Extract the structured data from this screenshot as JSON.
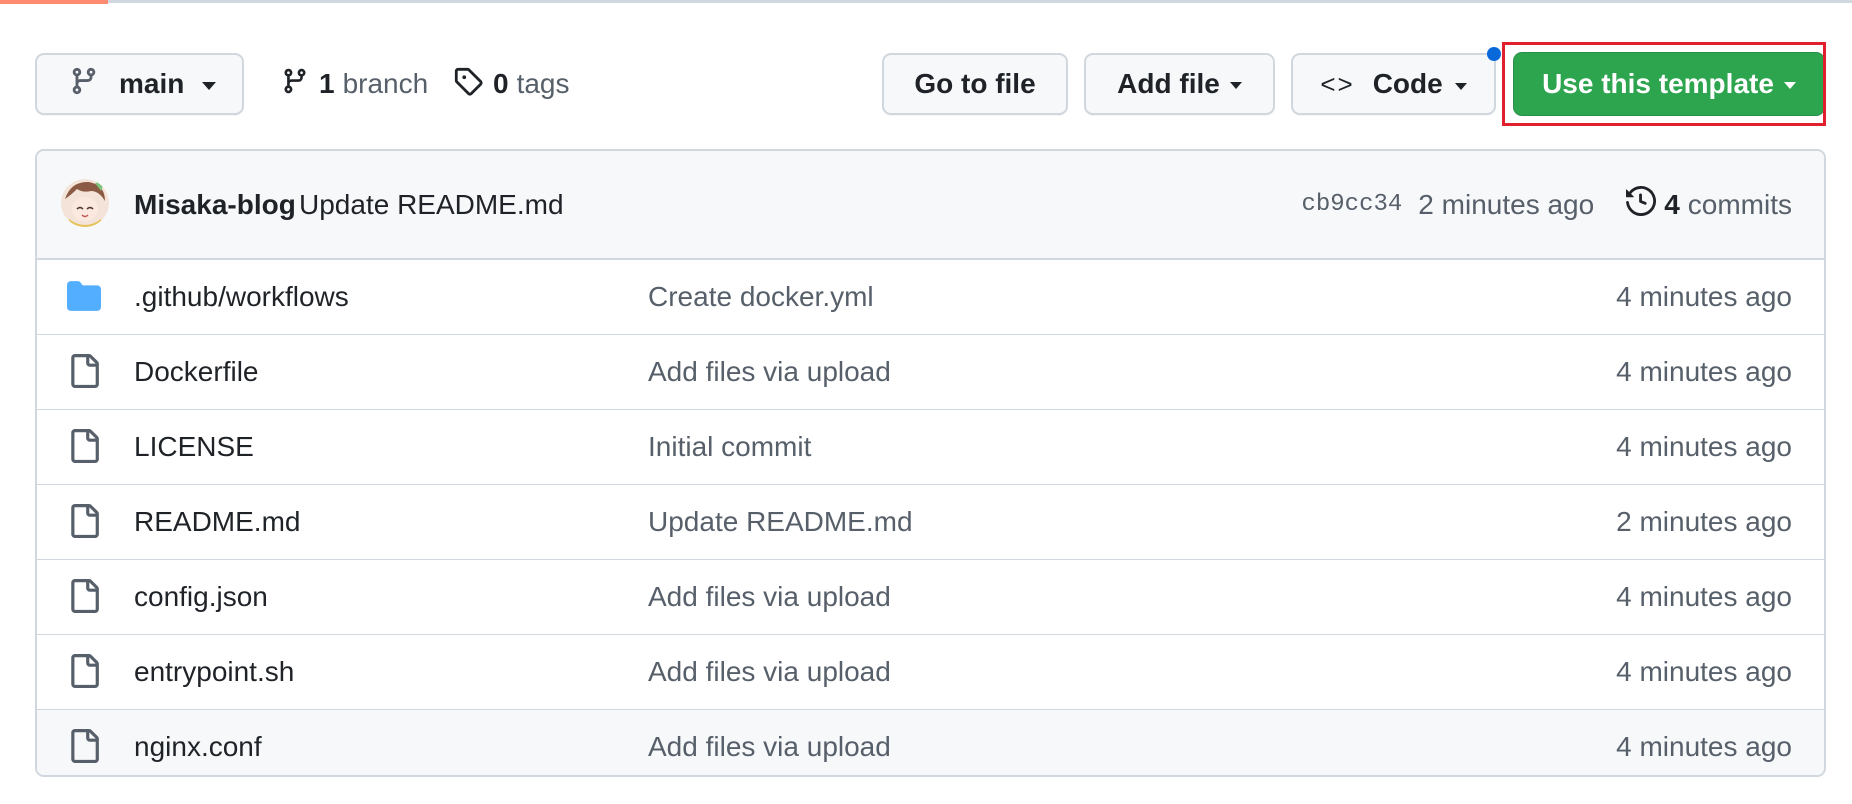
{
  "colors": {
    "accent_green": "#2da44e",
    "highlight_red": "#e0202c",
    "folder_blue": "#54aeff",
    "notification_blue": "#0969da"
  },
  "toolbar": {
    "branch_name": "main",
    "branches_count": "1",
    "branches_label": "branch",
    "tags_count": "0",
    "tags_label": "tags",
    "go_to_file_label": "Go to file",
    "add_file_label": "Add file",
    "code_icon_glyph": "<>",
    "code_label": "Code",
    "use_template_label": "Use this template"
  },
  "latest_commit": {
    "author": "Misaka-blog",
    "message": "Update README.md",
    "sha": "cb9cc34",
    "time": "2 minutes ago",
    "commits_count": "4",
    "commits_label": "commits"
  },
  "files": [
    {
      "type": "folder",
      "icon": "folder-icon",
      "name": ".github/workflows",
      "message": "Create docker.yml",
      "time": "4 minutes ago"
    },
    {
      "type": "file",
      "icon": "file-icon",
      "name": "Dockerfile",
      "message": "Add files via upload",
      "time": "4 minutes ago"
    },
    {
      "type": "file",
      "icon": "file-icon",
      "name": "LICENSE",
      "message": "Initial commit",
      "time": "4 minutes ago"
    },
    {
      "type": "file",
      "icon": "file-icon",
      "name": "README.md",
      "message": "Update README.md",
      "time": "2 minutes ago"
    },
    {
      "type": "file",
      "icon": "file-icon",
      "name": "config.json",
      "message": "Add files via upload",
      "time": "4 minutes ago"
    },
    {
      "type": "file",
      "icon": "file-icon",
      "name": "entrypoint.sh",
      "message": "Add files via upload",
      "time": "4 minutes ago"
    },
    {
      "type": "file",
      "icon": "file-icon",
      "name": "nginx.conf",
      "message": "Add files via upload",
      "time": "4 minutes ago"
    }
  ]
}
